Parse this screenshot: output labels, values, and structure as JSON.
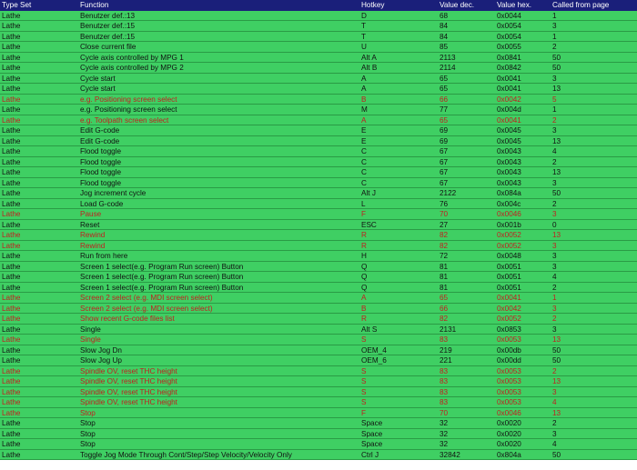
{
  "colors": {
    "header_bg": "#1a1f7a",
    "row_bg": "#3fcf63",
    "highlight_text": "#c02020"
  },
  "headers": [
    "Type Set",
    "Function",
    "Hotkey",
    "Value dec.",
    "Value hex.",
    "Called from page"
  ],
  "rows": [
    {
      "type": "Lathe",
      "function": "Benutzer def.:13",
      "hotkey": "D",
      "dec": "68",
      "hex": "0x0044",
      "page": "1",
      "red": false
    },
    {
      "type": "Lathe",
      "function": "Benutzer def.:15",
      "hotkey": "T",
      "dec": "84",
      "hex": "0x0054",
      "page": "3",
      "red": false
    },
    {
      "type": "Lathe",
      "function": "Benutzer def.:15",
      "hotkey": "T",
      "dec": "84",
      "hex": "0x0054",
      "page": "1",
      "red": false
    },
    {
      "type": "Lathe",
      "function": "Close current file",
      "hotkey": "U",
      "dec": "85",
      "hex": "0x0055",
      "page": "2",
      "red": false
    },
    {
      "type": "Lathe",
      "function": "Cycle axis controlled by MPG 1",
      "hotkey": "Alt A",
      "dec": "2113",
      "hex": "0x0841",
      "page": "50",
      "red": false
    },
    {
      "type": "Lathe",
      "function": "Cycle axis controlled by MPG 2",
      "hotkey": "Alt B",
      "dec": "2114",
      "hex": "0x0842",
      "page": "50",
      "red": false
    },
    {
      "type": "Lathe",
      "function": "Cycle start",
      "hotkey": "A",
      "dec": "65",
      "hex": "0x0041",
      "page": "3",
      "red": false
    },
    {
      "type": "Lathe",
      "function": "Cycle start",
      "hotkey": "A",
      "dec": "65",
      "hex": "0x0041",
      "page": "13",
      "red": false
    },
    {
      "type": "Lathe",
      "function": "e.g. Positioning screen select",
      "hotkey": "B",
      "dec": "66",
      "hex": "0x0042",
      "page": "5",
      "red": true
    },
    {
      "type": "Lathe",
      "function": "e.g. Positioning screen select",
      "hotkey": "M",
      "dec": "77",
      "hex": "0x004d",
      "page": "1",
      "red": false
    },
    {
      "type": "Lathe",
      "function": "e.g. Toolpath screen select",
      "hotkey": "A",
      "dec": "65",
      "hex": "0x0041",
      "page": "2",
      "red": true
    },
    {
      "type": "Lathe",
      "function": "Edit G-code",
      "hotkey": "E",
      "dec": "69",
      "hex": "0x0045",
      "page": "3",
      "red": false
    },
    {
      "type": "Lathe",
      "function": "Edit G-code",
      "hotkey": "E",
      "dec": "69",
      "hex": "0x0045",
      "page": "13",
      "red": false
    },
    {
      "type": "Lathe",
      "function": "Flood toggle",
      "hotkey": "C",
      "dec": "67",
      "hex": "0x0043",
      "page": "4",
      "red": false
    },
    {
      "type": "Lathe",
      "function": "Flood toggle",
      "hotkey": "C",
      "dec": "67",
      "hex": "0x0043",
      "page": "2",
      "red": false
    },
    {
      "type": "Lathe",
      "function": "Flood toggle",
      "hotkey": "C",
      "dec": "67",
      "hex": "0x0043",
      "page": "13",
      "red": false
    },
    {
      "type": "Lathe",
      "function": "Flood toggle",
      "hotkey": "C",
      "dec": "67",
      "hex": "0x0043",
      "page": "3",
      "red": false
    },
    {
      "type": "Lathe",
      "function": "Jog increment cycle",
      "hotkey": "Alt J",
      "dec": "2122",
      "hex": "0x084a",
      "page": "50",
      "red": false
    },
    {
      "type": "Lathe",
      "function": "Load G-code",
      "hotkey": "L",
      "dec": "76",
      "hex": "0x004c",
      "page": "2",
      "red": false
    },
    {
      "type": "Lathe",
      "function": "Pause",
      "hotkey": "F",
      "dec": "70",
      "hex": "0x0046",
      "page": "3",
      "red": true
    },
    {
      "type": "Lathe",
      "function": "Reset",
      "hotkey": "ESC",
      "dec": "27",
      "hex": "0x001b",
      "page": "0",
      "red": false
    },
    {
      "type": "Lathe",
      "function": "Rewind",
      "hotkey": "R",
      "dec": "82",
      "hex": "0x0052",
      "page": "13",
      "red": true
    },
    {
      "type": "Lathe",
      "function": "Rewind",
      "hotkey": "R",
      "dec": "82",
      "hex": "0x0052",
      "page": "3",
      "red": true
    },
    {
      "type": "Lathe",
      "function": "Run from here",
      "hotkey": "H",
      "dec": "72",
      "hex": "0x0048",
      "page": "3",
      "red": false
    },
    {
      "type": "Lathe",
      "function": "Screen 1 select(e.g. Program Run screen) Button",
      "hotkey": "Q",
      "dec": "81",
      "hex": "0x0051",
      "page": "3",
      "red": false
    },
    {
      "type": "Lathe",
      "function": "Screen 1 select(e.g. Program Run screen) Button",
      "hotkey": "Q",
      "dec": "81",
      "hex": "0x0051",
      "page": "4",
      "red": false
    },
    {
      "type": "Lathe",
      "function": "Screen 1 select(e.g. Program Run screen) Button",
      "hotkey": "Q",
      "dec": "81",
      "hex": "0x0051",
      "page": "2",
      "red": false
    },
    {
      "type": "Lathe",
      "function": "Screen 2 select (e.g. MDI screen select)",
      "hotkey": "A",
      "dec": "65",
      "hex": "0x0041",
      "page": "1",
      "red": true
    },
    {
      "type": "Lathe",
      "function": "Screen 2 select (e.g. MDI screen select)",
      "hotkey": "B",
      "dec": "66",
      "hex": "0x0042",
      "page": "3",
      "red": true
    },
    {
      "type": "Lathe",
      "function": "Show recent G-code files list",
      "hotkey": "R",
      "dec": "82",
      "hex": "0x0052",
      "page": "2",
      "red": true
    },
    {
      "type": "Lathe",
      "function": "Single",
      "hotkey": "Alt S",
      "dec": "2131",
      "hex": "0x0853",
      "page": "3",
      "red": false
    },
    {
      "type": "Lathe",
      "function": "Single",
      "hotkey": "S",
      "dec": "83",
      "hex": "0x0053",
      "page": "13",
      "red": true
    },
    {
      "type": "Lathe",
      "function": "Slow Jog Dn",
      "hotkey": "OEM_4",
      "dec": "219",
      "hex": "0x00db",
      "page": "50",
      "red": false
    },
    {
      "type": "Lathe",
      "function": "Slow Jog Up",
      "hotkey": "OEM_6",
      "dec": "221",
      "hex": "0x00dd",
      "page": "50",
      "red": false
    },
    {
      "type": "Lathe",
      "function": "Spindle OV, reset THC height",
      "hotkey": "S",
      "dec": "83",
      "hex": "0x0053",
      "page": "2",
      "red": true
    },
    {
      "type": "Lathe",
      "function": "Spindle OV, reset THC height",
      "hotkey": "S",
      "dec": "83",
      "hex": "0x0053",
      "page": "13",
      "red": true
    },
    {
      "type": "Lathe",
      "function": "Spindle OV, reset THC height",
      "hotkey": "S",
      "dec": "83",
      "hex": "0x0053",
      "page": "3",
      "red": true
    },
    {
      "type": "Lathe",
      "function": "Spindle OV, reset THC height",
      "hotkey": "S",
      "dec": "83",
      "hex": "0x0053",
      "page": "4",
      "red": true
    },
    {
      "type": "Lathe",
      "function": "Stop",
      "hotkey": "F",
      "dec": "70",
      "hex": "0x0046",
      "page": "13",
      "red": true
    },
    {
      "type": "Lathe",
      "function": "Stop",
      "hotkey": "Space",
      "dec": "32",
      "hex": "0x0020",
      "page": "2",
      "red": false
    },
    {
      "type": "Lathe",
      "function": "Stop",
      "hotkey": "Space",
      "dec": "32",
      "hex": "0x0020",
      "page": "3",
      "red": false
    },
    {
      "type": "Lathe",
      "function": "Stop",
      "hotkey": "Space",
      "dec": "32",
      "hex": "0x0020",
      "page": "4",
      "red": false
    },
    {
      "type": "Lathe",
      "function": "Toggle Jog Mode Through Cont/Step/Step Velocity/Velocity Only",
      "hotkey": "Ctrl J",
      "dec": "32842",
      "hex": "0x804a",
      "page": "50",
      "red": false
    }
  ]
}
